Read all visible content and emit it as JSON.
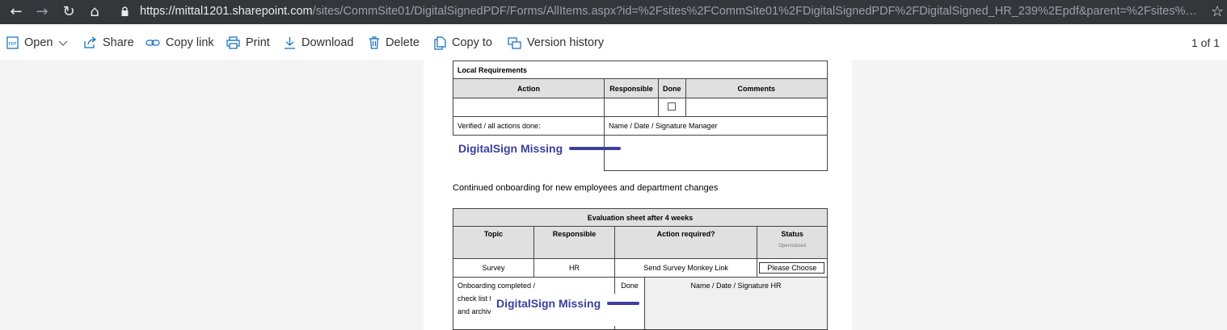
{
  "browser": {
    "url_host": "https://mittal1201.sharepoint.com",
    "url_path": "/sites/CommSite01/DigitalSignedPDF/Forms/AllItems.aspx?id=%2Fsites%2FCommSite01%2FDigitalSignedPDF%2FDigitalSigned_HR_239%2Epdf&parent=%2Fsites%2FCommSite..."
  },
  "toolbar": {
    "open": "Open",
    "share": "Share",
    "copy_link": "Copy link",
    "print": "Print",
    "download": "Download",
    "delete": "Delete",
    "copy_to": "Copy to",
    "version_history": "Version history",
    "page_count": "1 of 1"
  },
  "doc": {
    "local_req_title": "Local Requirements",
    "headers": [
      "Action",
      "Responsible",
      "Done",
      "Comments"
    ],
    "verified": "Verified / all actions done:",
    "signature_manager": "Name / Date / Signature Manager",
    "digitalsign_missing": "DigitalSign Missing",
    "continued": "Continued onboarding for new employees and department changes",
    "eval_title": "Evaluation sheet after 4 weeks",
    "eval_headers": [
      "Topic",
      "Responsible",
      "Action required?",
      "Status"
    ],
    "status_sub": "Open/closed",
    "row_survey": [
      "Survey",
      "HR",
      "Send Survey Monkey Link"
    ],
    "please_choose": "Please Choose",
    "onboard_line1": "Onboarding completed /",
    "onboard_line2": "check list fo",
    "onboard_line3": "and archive",
    "done": "Done",
    "signature_hr": "Name / Date / Signature HR"
  }
}
